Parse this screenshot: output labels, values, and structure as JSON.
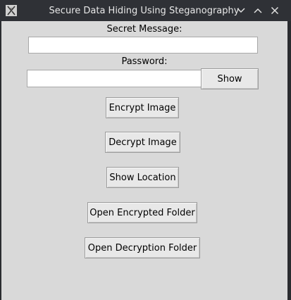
{
  "window": {
    "title": "Secure Data Hiding Using Steganography"
  },
  "form": {
    "message_label": "Secret Message:",
    "message_value": "",
    "password_label": "Password:",
    "password_value": "",
    "show_button": "Show"
  },
  "actions": {
    "encrypt": "Encrypt Image",
    "decrypt": "Decrypt Image",
    "show_location": "Show Location",
    "open_encrypted": "Open Encrypted Folder",
    "open_decryption": "Open Decryption Folder"
  },
  "icons": {
    "app": "app-icon",
    "minimize": "chevron-down-icon",
    "maximize": "chevron-up-icon",
    "close": "close-icon"
  },
  "colors": {
    "titlebar": "#2f3136",
    "client_bg": "#d9d9d9",
    "button_bg": "#e8e8e8"
  }
}
